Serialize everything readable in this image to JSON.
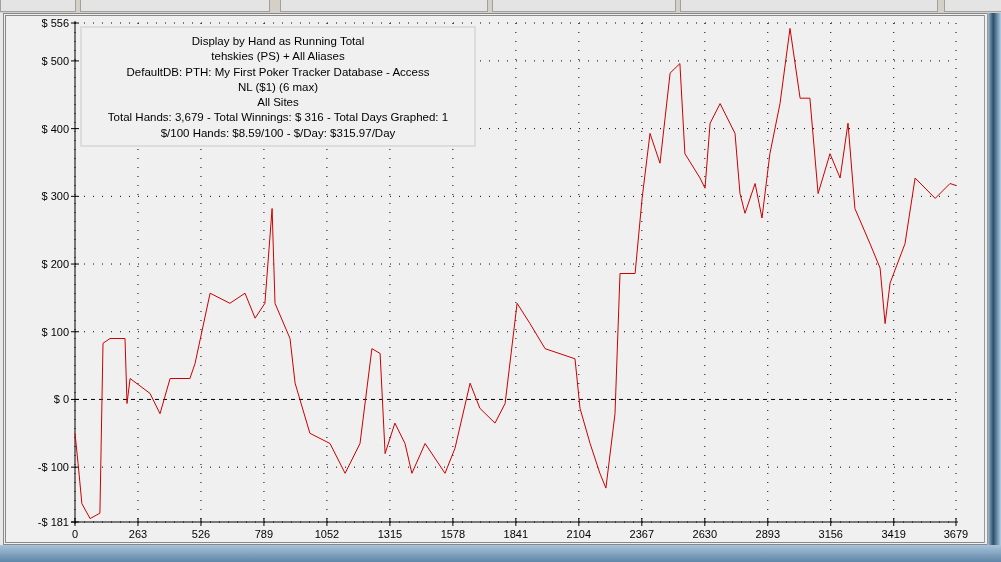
{
  "chart": {
    "legend": {
      "lines": [
        "Display by Hand as Running Total",
        "tehskies (PS) + All Aliases",
        "DefaultDB: PTH: My First Poker Tracker Database - Access",
        "NL ($1) (6 max)",
        "All Sites",
        "Total Hands: 3,679 - Total Winnings: $ 316 - Total Days Graphed: 1",
        "$/100 Hands: $8.59/100 - $/Day: $315.97/Day"
      ]
    },
    "chart_data": {
      "type": "line",
      "x": [
        0,
        13,
        29,
        63,
        104,
        117,
        146,
        209,
        217,
        230,
        313,
        355,
        397,
        480,
        501,
        564,
        647,
        710,
        752,
        793,
        823,
        835,
        898,
        919,
        981,
        1065,
        1128,
        1190,
        1240,
        1274,
        1295,
        1336,
        1378,
        1407,
        1462,
        1545,
        1587,
        1650,
        1691,
        1754,
        1796,
        1846,
        1900,
        1963,
        2088,
        2109,
        2151,
        2192,
        2217,
        2255,
        2276,
        2339,
        2368,
        2401,
        2443,
        2485,
        2526,
        2547,
        2610,
        2631,
        2652,
        2694,
        2756,
        2777,
        2798,
        2840,
        2869,
        2902,
        2944,
        2986,
        3028,
        3069,
        3103,
        3153,
        3195,
        3228,
        3257,
        3320,
        3362,
        3383,
        3404,
        3466,
        3508,
        3592,
        3654,
        3679
      ],
      "series": [
        {
          "color": "#cc0000",
          "values": [
            -50,
            -95,
            -154,
            -176,
            -168,
            83,
            90,
            90,
            -6,
            31,
            9,
            -21,
            31,
            31,
            53,
            157,
            142,
            157,
            120,
            142,
            282,
            142,
            90,
            24,
            -50,
            -65,
            -109,
            -65,
            75,
            68,
            -80,
            -35,
            -65,
            -109,
            -65,
            -109,
            -72,
            24,
            -13,
            -35,
            -6,
            142,
            112,
            75,
            60,
            -13,
            -65,
            -109,
            -131,
            -21,
            186,
            186,
            297,
            393,
            349,
            482,
            496,
            363,
            327,
            312,
            408,
            437,
            393,
            304,
            275,
            319,
            268,
            363,
            437,
            548,
            445,
            445,
            304,
            363,
            327,
            408,
            282,
            230,
            194,
            112,
            172,
            230,
            327,
            297,
            319,
            316
          ]
        }
      ],
      "grid": true,
      "xlim": [
        0,
        3679
      ],
      "ylim": [
        -181,
        556
      ],
      "xticks": [
        0,
        263,
        526,
        789,
        1052,
        1315,
        1578,
        1841,
        2104,
        2367,
        2630,
        2893,
        3156,
        3419,
        3679
      ],
      "yticks": [
        {
          "value": 556,
          "label": "$ 556"
        },
        {
          "value": 500,
          "label": "$ 500"
        },
        {
          "value": 400,
          "label": "$ 400"
        },
        {
          "value": 300,
          "label": "$ 300"
        },
        {
          "value": 200,
          "label": "$ 200"
        },
        {
          "value": 100,
          "label": "$ 100"
        },
        {
          "value": 0,
          "label": "$ 0"
        },
        {
          "value": -100,
          "label": "-$ 100"
        },
        {
          "value": -181,
          "label": "-$ 181"
        }
      ]
    }
  }
}
